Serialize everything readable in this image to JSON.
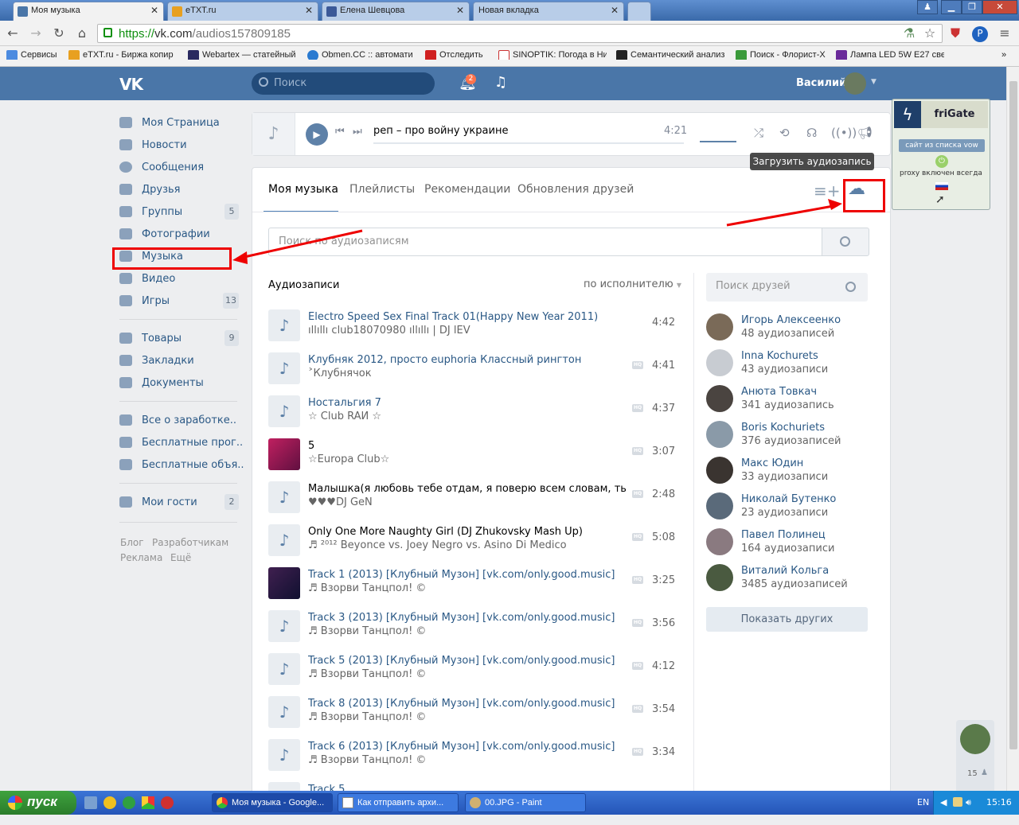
{
  "browser": {
    "tabs": [
      {
        "title": "Моя музыка",
        "active": true
      },
      {
        "title": "eTXT.ru",
        "active": false
      },
      {
        "title": "Елена Шевцова",
        "active": false
      },
      {
        "title": "Новая вкладка",
        "active": false
      }
    ],
    "url_scheme": "https://",
    "url_host": "vk.com",
    "url_path": "/audios157809185",
    "bookmarks": [
      "Сервисы",
      "eTXT.ru - Биржа копир",
      "Webartex — статейный",
      "Obmen.CC :: автомати",
      "Отследить",
      "SINOPTIK: Погода в Ни",
      "Семантический анализ",
      "Поиск - Флорист-Х",
      "Лампа LED 5W E27 свет"
    ]
  },
  "vk": {
    "logo": "VK",
    "search_placeholder": "Поиск",
    "notif_count": "2",
    "user_name": "Василий"
  },
  "nav": {
    "items": [
      {
        "label": "Моя Страница",
        "count": ""
      },
      {
        "label": "Новости",
        "count": ""
      },
      {
        "label": "Сообщения",
        "count": ""
      },
      {
        "label": "Друзья",
        "count": ""
      },
      {
        "label": "Группы",
        "count": "5"
      },
      {
        "label": "Фотографии",
        "count": ""
      },
      {
        "label": "Музыка",
        "count": ""
      },
      {
        "label": "Видео",
        "count": ""
      },
      {
        "label": "Игры",
        "count": "13"
      },
      {
        "label": "Товары",
        "count": "9"
      },
      {
        "label": "Закладки",
        "count": ""
      },
      {
        "label": "Документы",
        "count": ""
      },
      {
        "label": "Все о заработке..",
        "count": ""
      },
      {
        "label": "Бесплатные прог..",
        "count": ""
      },
      {
        "label": "Бесплатные объя..",
        "count": ""
      },
      {
        "label": "Мои гости",
        "count": "2"
      }
    ],
    "footer": {
      "blog": "Блог",
      "dev": "Разработчикам",
      "ads": "Реклама",
      "more": "Ещё"
    }
  },
  "player": {
    "track": "реп – про войну украине",
    "time": "4:21"
  },
  "tooltip": "Загрузить аудиозапись",
  "main": {
    "tabs": [
      "Моя музыка",
      "Плейлисты",
      "Рекомендации",
      "Обновления друзей"
    ],
    "search_placeholder": "Поиск по аудиозаписям",
    "section_title": "Аудиозаписи",
    "sort": "по исполнителю",
    "tracks": [
      {
        "title": "Electro Speed Sex Final Track 01(Happy New Year 2011)",
        "artist": "ıllıllı club18070980 ıllıllı | DJ lEV",
        "duration": "4:42",
        "hq": false,
        "link": true,
        "cover": "note"
      },
      {
        "title": "Клубняк 2012, просто euphoria Классный рингтон",
        "artist": "˃Клубнячок",
        "duration": "4:41",
        "hq": true,
        "link": true,
        "cover": "note"
      },
      {
        "title": "Ностальгия 7",
        "artist": "☆ Club RAЙ ☆",
        "duration": "4:37",
        "hq": true,
        "link": true,
        "cover": "note"
      },
      {
        "title": "5",
        "artist": "☆Europa Club☆",
        "duration": "3:07",
        "hq": true,
        "link": false,
        "cover": "art-pink"
      },
      {
        "title": "Малышка(я любовь тебе отдам, я поверю всем словам, ты же д...",
        "artist": "♥♥♥DJ GeN",
        "duration": "2:48",
        "hq": true,
        "link": false,
        "cover": "note"
      },
      {
        "title": "Only One More Naughty Girl (DJ Zhukovsky Mash Up)",
        "artist": "♬ ²⁰¹² Beyonce vs. Joey Negro vs. Asino Di Medico",
        "duration": "5:08",
        "hq": true,
        "link": false,
        "cover": "note"
      },
      {
        "title": "Track 1 (2013) [Клубный Музон] [vk.com/only.good.music]",
        "artist": "♬ Взорви Танцпол! ©",
        "duration": "3:25",
        "hq": true,
        "link": true,
        "cover": "art-dark"
      },
      {
        "title": "Track 3 (2013) [Клубный Музон] [vk.com/only.good.music]",
        "artist": "♬ Взорви Танцпол! ©",
        "duration": "3:56",
        "hq": true,
        "link": true,
        "cover": "note"
      },
      {
        "title": "Track 5 (2013) [Клубный Музон] [vk.com/only.good.music]",
        "artist": "♬ Взорви Танцпол! ©",
        "duration": "4:12",
        "hq": true,
        "link": true,
        "cover": "note"
      },
      {
        "title": "Track 8 (2013) [Клубный Музон] [vk.com/only.good.music]",
        "artist": "♬ Взорви Танцпол! ©",
        "duration": "3:54",
        "hq": true,
        "link": true,
        "cover": "note"
      },
      {
        "title": "Track 6 (2013) [Клубный Музон] [vk.com/only.good.music]",
        "artist": "♬ Взорви Танцпол! ©",
        "duration": "3:34",
        "hq": true,
        "link": true,
        "cover": "note"
      },
      {
        "title": "Track 5",
        "artist": "",
        "duration": "",
        "hq": false,
        "link": true,
        "cover": "note"
      }
    ]
  },
  "friends": {
    "search_placeholder": "Поиск друзей",
    "list": [
      {
        "name": "Игорь Алексеенко",
        "count": "48 аудиозаписей"
      },
      {
        "name": "Inna Kochurets",
        "count": "43 аудиозаписи"
      },
      {
        "name": "Анюта Товкач",
        "count": "341 аудиозапись"
      },
      {
        "name": "Boris Kochuriets",
        "count": "376 аудиозаписей"
      },
      {
        "name": "Макс Юдин",
        "count": "33 аудиозаписи"
      },
      {
        "name": "Николай Бутенко",
        "count": "23 аудиозаписи"
      },
      {
        "name": "Павел Полинец",
        "count": "164 аудиозаписи"
      },
      {
        "name": "Виталий Кольга",
        "count": "3485 аудиозаписей"
      }
    ],
    "show_more": "Показать других"
  },
  "frigate": {
    "title": "friGate",
    "status": "сайт из списка vow",
    "proxy": "proxy включен всегда"
  },
  "online_count": "15",
  "taskbar": {
    "start": "пуск",
    "windows": [
      "Моя музыка - Google...",
      "Как отправить архи...",
      "00.JPG - Paint"
    ],
    "lang": "EN",
    "clock": "15:16"
  }
}
